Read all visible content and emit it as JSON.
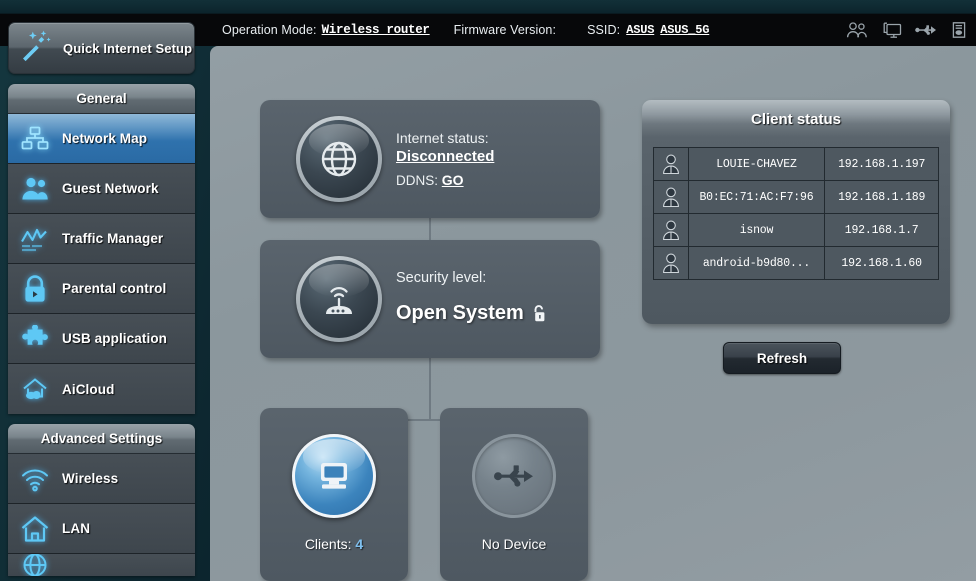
{
  "header": {
    "operation_mode_label": "Operation Mode:",
    "operation_mode_value": "Wireless router",
    "firmware_label": "Firmware Version:",
    "firmware_value": "",
    "ssid_label": "SSID:",
    "ssid_1": "ASUS",
    "ssid_2": "ASUS_5G",
    "icons": [
      "clients-icon",
      "display-icon",
      "usb-icon",
      "printer-icon"
    ]
  },
  "sidebar": {
    "quick_setup_label": "Quick Internet Setup",
    "quick_setup_icon": "magic-wand-icon",
    "general_group": {
      "title": "General",
      "items": [
        {
          "label": "Network Map",
          "icon": "network-map-icon",
          "active": true
        },
        {
          "label": "Guest Network",
          "icon": "guest-network-icon",
          "active": false
        },
        {
          "label": "Traffic Manager",
          "icon": "traffic-manager-icon",
          "active": false
        },
        {
          "label": "Parental control",
          "icon": "parental-control-icon",
          "active": false
        },
        {
          "label": "USB application",
          "icon": "usb-application-icon",
          "active": false
        },
        {
          "label": "AiCloud",
          "icon": "aicloud-icon",
          "active": false
        }
      ]
    },
    "advanced_group": {
      "title": "Advanced Settings",
      "items": [
        {
          "label": "Wireless",
          "icon": "wireless-icon",
          "active": false
        },
        {
          "label": "LAN",
          "icon": "lan-home-icon",
          "active": false
        }
      ]
    }
  },
  "main": {
    "internet": {
      "status_label": "Internet status:",
      "status_value": "Disconnected",
      "ddns_label": "DDNS:",
      "ddns_action": "GO",
      "icon": "globe-icon"
    },
    "security": {
      "level_label": "Security level:",
      "level_value": "Open System",
      "lock_icon": "open-lock-icon",
      "icon": "router-signal-icon"
    },
    "devices": [
      {
        "label_prefix": "Clients:",
        "count": "4",
        "icon": "monitor-icon",
        "state": "active"
      },
      {
        "label_prefix": "No Device",
        "count": "",
        "icon": "usb-icon",
        "state": "inactive"
      }
    ]
  },
  "client_status": {
    "title": "Client status",
    "refresh_label": "Refresh",
    "rows": [
      {
        "icon": "person-icon",
        "name": "LOUIE-CHAVEZ",
        "ip": "192.168.1.197"
      },
      {
        "icon": "person-icon",
        "name": "B0:EC:71:AC:F7:96",
        "ip": "192.168.1.189"
      },
      {
        "icon": "person-icon",
        "name": "isnow",
        "ip": "192.168.1.7"
      },
      {
        "icon": "person-icon",
        "name": "android-b9d80...",
        "ip": "192.168.1.60"
      }
    ]
  },
  "colors": {
    "accent_blue": "#2f72ad",
    "icon_cyan": "#5ec8f5",
    "content_bg": "#8b979d",
    "panel_bg": "#545e67",
    "count_blue": "#7fc0ef"
  }
}
